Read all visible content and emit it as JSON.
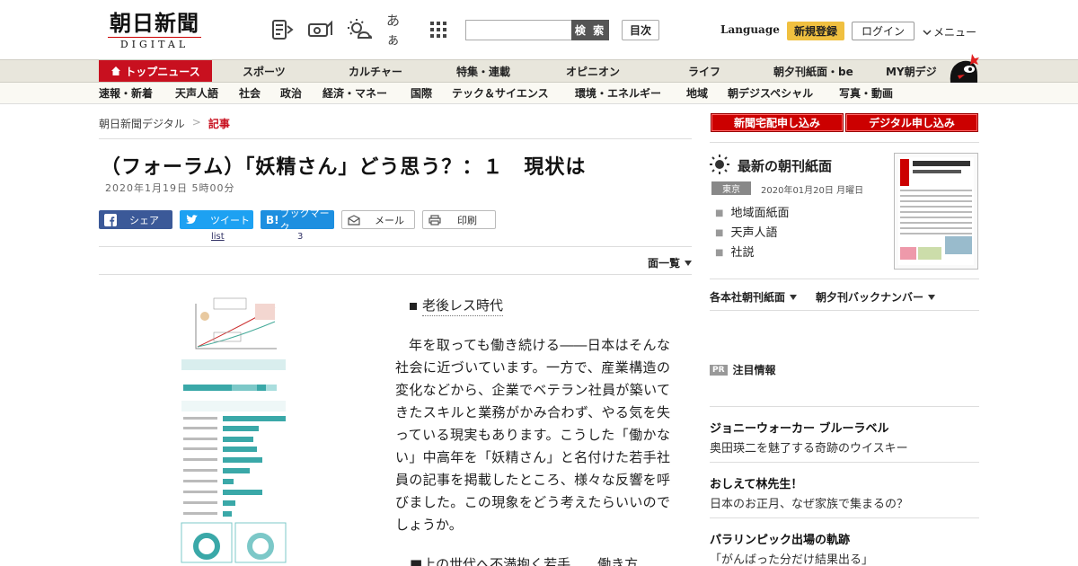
{
  "header": {
    "logo_ja": "朝日新聞",
    "logo_en": "DIGITAL",
    "icons": [
      "newspaper-icon",
      "camera-icon",
      "weather-icon",
      "text-size-icon",
      "grid-icon"
    ],
    "text_size_label": "あぁ",
    "search_label": "検 索",
    "search_placeholder": "",
    "index_label": "目次",
    "language_label": "Language",
    "signup_label": "新規登録",
    "login_label": "ログイン",
    "menu_label": "メニュー"
  },
  "nav_primary": [
    "トップニュース",
    "スポーツ",
    "カルチャー",
    "特集・連載",
    "オピニオン",
    "ライフ",
    "朝夕刊紙面・be",
    "MY朝デジ"
  ],
  "nav_secondary": [
    "速報・新着",
    "天声人語",
    "社会",
    "政治",
    "経済・マネー",
    "国際",
    "テック＆サイエンス",
    "環境・エネルギー",
    "地域",
    "朝デジスペシャル",
    "写真・動画"
  ],
  "breadcrumb": {
    "home": "朝日新聞デジタル",
    "sep": ">",
    "current": "記事"
  },
  "article": {
    "title": "（フォーラム）「妖精さん」どう思う？：１　現状は",
    "date": "2020年1月19日 5時00分",
    "share": {
      "facebook": "シェア",
      "twitter": "ツイート",
      "twitter_count": "list",
      "hatena_icon": "B!",
      "hatena": "ブックマーク",
      "hatena_count": "3",
      "mail": "メール",
      "print": "印刷"
    },
    "pages_label": "面一覧",
    "subhead1": "老後レス時代",
    "body": "年を取っても働き続ける――日本はそんな社会に近づいています。一方で、産業構造の変化などから、企業でベテラン社員が築いてきたスキルと業務がかみ合わず、やる気を失っている現実もあります。こうした「働かない」中高年を「妖精さん」と名付けた若手社員の記事を掲載したところ、様々な反響を呼びました。この現象をどう考えたらいいのでしょうか。",
    "subhead2": "■上の世代へ不満抱く若手　　働き方"
  },
  "sidebar": {
    "home_delivery": "新聞宅配申し込み",
    "digital": "デジタル申し込み",
    "paper_title": "最新の朝刊紙面",
    "region": "東京",
    "paper_date": "2020年01月20日 月曜日",
    "paper_links": [
      "地域面紙面",
      "天声人語",
      "社説"
    ],
    "dropdown1": "各本社朝刊紙面",
    "dropdown2": "朝夕刊バックナンバー",
    "pr_tag": "PR",
    "pr_label": "注目情報",
    "promos": [
      {
        "title": "ジョニーウォーカー ブルーラベル",
        "sub": "奥田瑛二を魅了する奇跡のウイスキー"
      },
      {
        "title": "おしえて林先生！",
        "sub": "日本のお正月、なぜ家族で集まるの？"
      },
      {
        "title": "パラリンピック出場の軌跡",
        "sub": "「がんばった分だけ結果出る」"
      }
    ]
  },
  "colors": {
    "brand_red": "#c8101f",
    "facebook": "#3b5998",
    "twitter": "#1da1f2",
    "hatena": "#1d8fe0",
    "signup_yellow": "#f0c040"
  }
}
